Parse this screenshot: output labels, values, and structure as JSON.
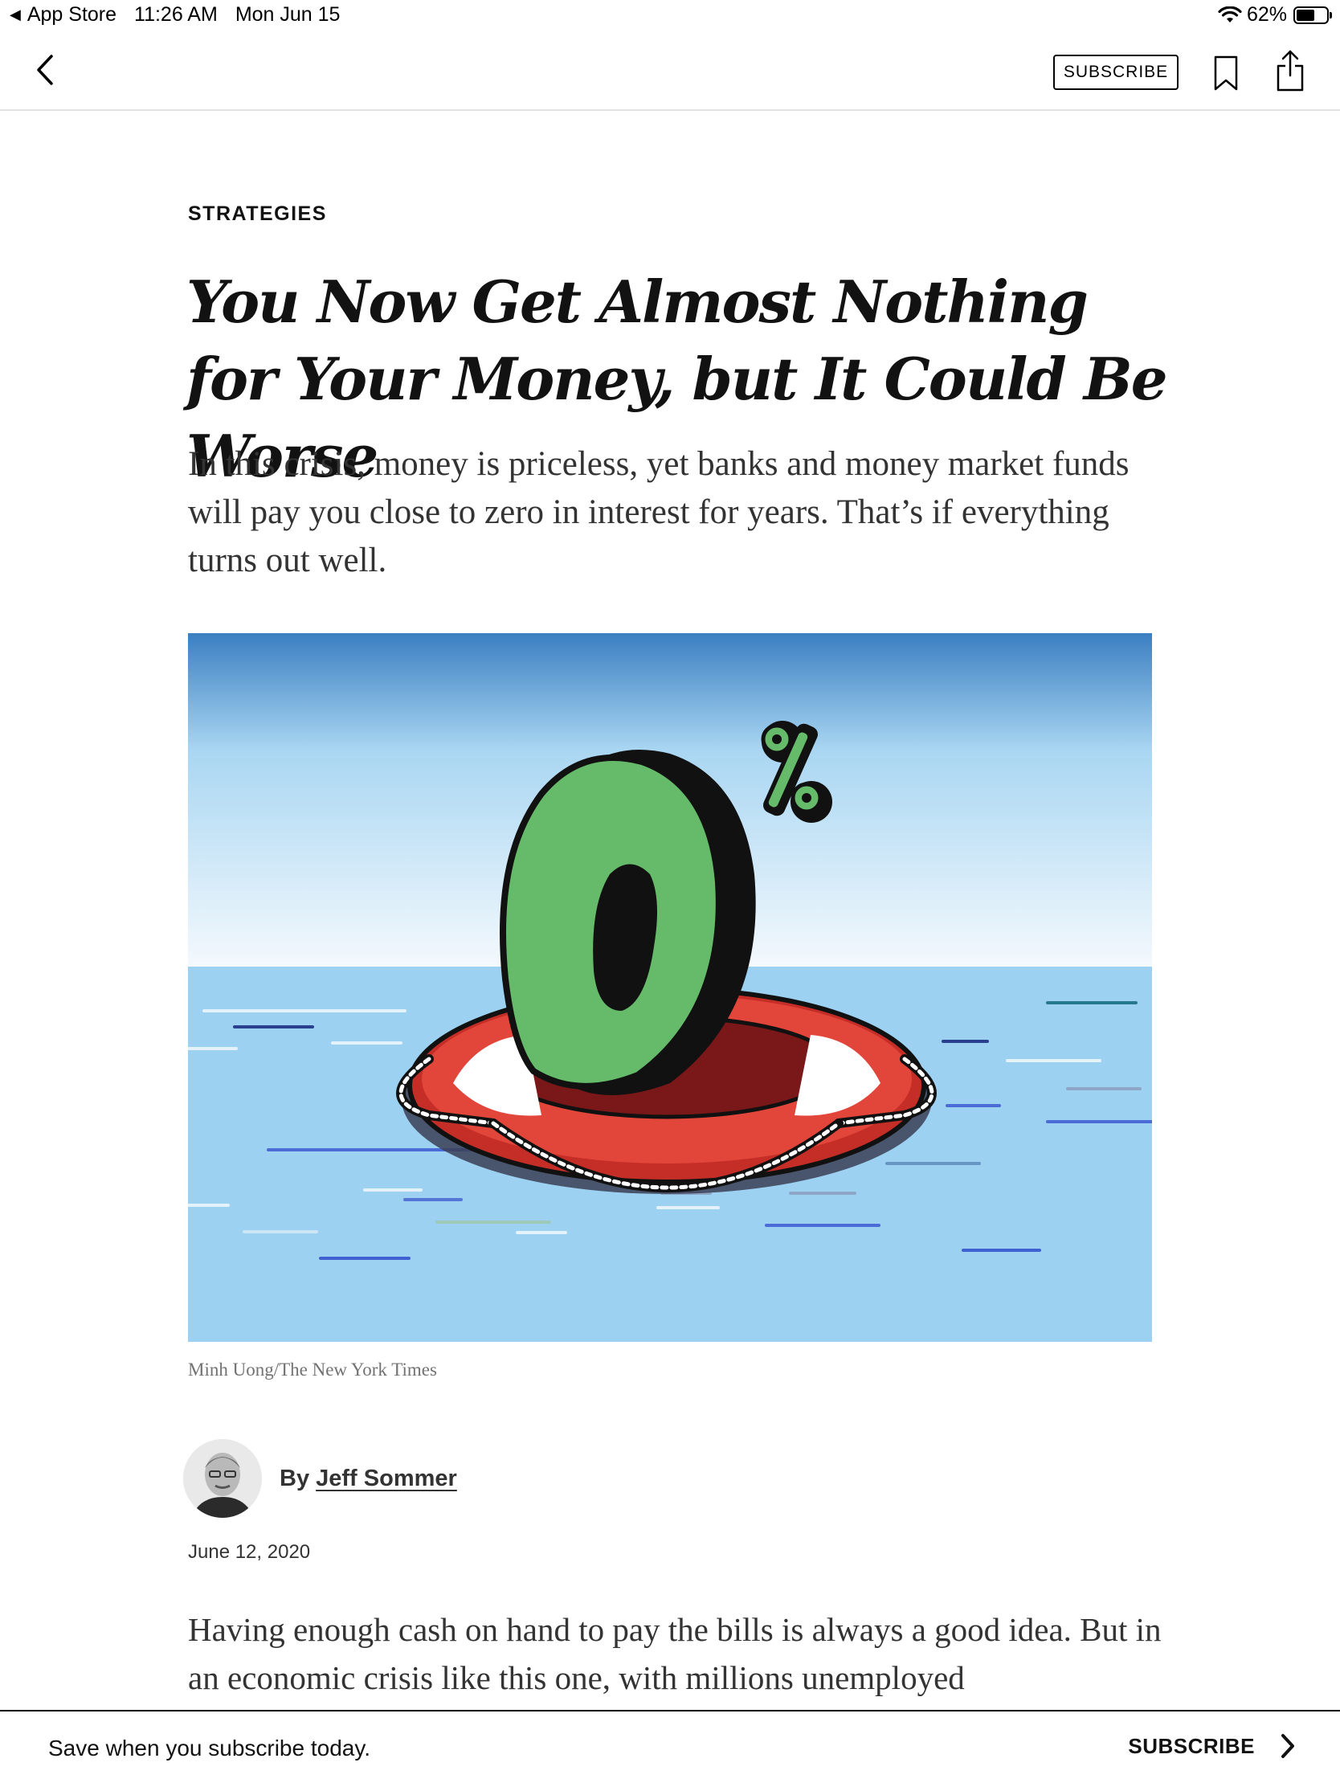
{
  "status_bar": {
    "back_app": "App Store",
    "time": "11:26 AM",
    "date": "Mon Jun 15",
    "battery": "62%",
    "battery_level": 0.62
  },
  "nav": {
    "subscribe_label": "SUBSCRIBE",
    "icons": [
      "chevron-left-icon",
      "bookmark-icon",
      "share-icon"
    ]
  },
  "article": {
    "kicker": "STRATEGIES",
    "headline": "You Now Get Almost Nothing for Your Money, but It Could Be Worse",
    "dek": "In this crisis, money is priceless, yet banks and money market funds will pay you close to zero in interest for years. That’s if everything turns out well.",
    "image_credit": "Minh Uong/The New York Times",
    "byline_prefix": "By",
    "author": "Jeff Sommer",
    "date": "June 12, 2020",
    "body": "Having enough cash on hand to pay the bills is always a good idea. But in an economic crisis like this one, with millions unemployed"
  },
  "hero_image": {
    "numeral": "0",
    "symbol": "%"
  },
  "banner": {
    "text": "Save when you subscribe today.",
    "cta": "SUBSCRIBE"
  },
  "colors": {
    "sky_top": "#3b7fc1",
    "sky_bottom": "#f4f9fd",
    "water": "#9dd1f1",
    "zero_green": "#66bb6a",
    "ring_red": "#d9372f",
    "text": "#121212"
  }
}
